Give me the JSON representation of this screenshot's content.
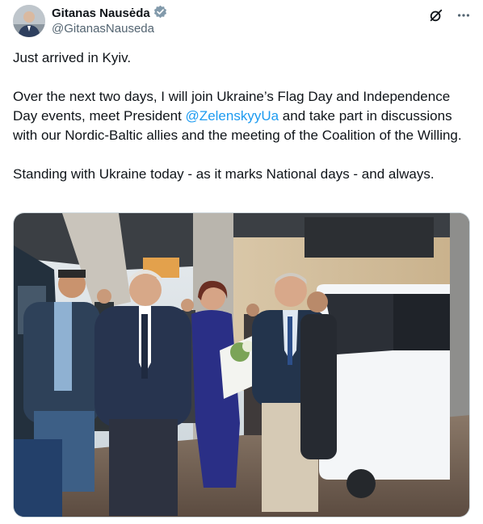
{
  "author": {
    "display_name": "Gitanas Nausėda",
    "handle": "@GitanasNauseda",
    "verified_icon": "verified-badge-icon"
  },
  "actions": {
    "grok_icon": "grok-icon",
    "more_icon": "more-options-icon"
  },
  "tweet": {
    "line1": "Just arrived in Kyiv.",
    "para2_before": "Over the next two days, I will join Ukraine’s Flag Day and Independence Day events, meet President ",
    "para2_mention": "@ZelenskyyUa",
    "para2_after": " and take part in discussions with our Nordic-Baltic allies and the meeting of the Coalition of the Willing.",
    "para3": "Standing with Ukraine today - as it marks National days - and always."
  },
  "media": {
    "type": "photo",
    "colors": {
      "platform": "#6e5f55",
      "van": "#f4f6f8",
      "suit_navy": "#27344f",
      "dress": "#2a2f86"
    }
  }
}
